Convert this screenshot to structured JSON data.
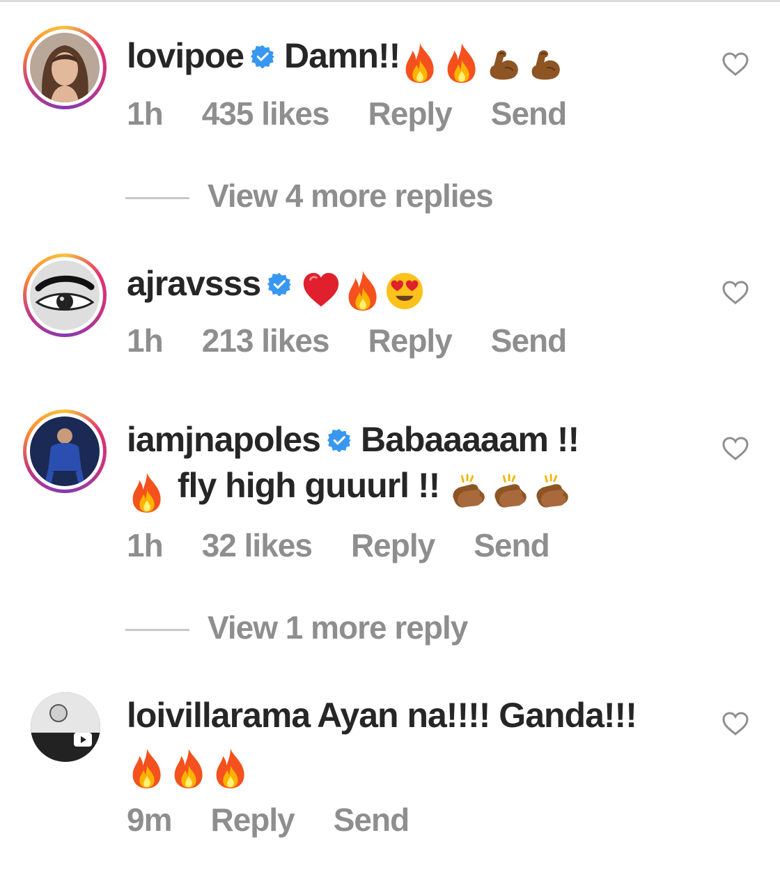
{
  "comments": [
    {
      "username": "lovipoe",
      "verified": true,
      "text": "Damn!!",
      "emoji": [
        "fire",
        "fire",
        "flexed-biceps",
        "flexed-biceps"
      ],
      "time": "1h",
      "likes": "435 likes",
      "reply_label": "Reply",
      "send_label": "Send",
      "view_replies": "View 4 more replies"
    },
    {
      "username": "ajravsss",
      "verified": true,
      "text": "",
      "emoji": [
        "red-heart",
        "fire",
        "heart-eyes"
      ],
      "time": "1h",
      "likes": "213 likes",
      "reply_label": "Reply",
      "send_label": "Send"
    },
    {
      "username": "iamjnapoles",
      "verified": true,
      "text": "Babaaaaam !!",
      "text_line2": "fly high guuurl !!",
      "emoji": [
        "fire",
        "clapping-hands",
        "clapping-hands",
        "clapping-hands"
      ],
      "time": "1h",
      "likes": "32 likes",
      "reply_label": "Reply",
      "send_label": "Send",
      "view_replies": "View 1 more reply"
    },
    {
      "username": "loivillarama",
      "verified": false,
      "text": "Ayan na!!!! Ganda!!!",
      "emoji": [
        "fire",
        "fire",
        "fire"
      ],
      "time": "9m",
      "reply_label": "Reply",
      "send_label": "Send"
    }
  ],
  "colors": {
    "text": "#262626",
    "meta": "#8e8e8e",
    "verified": "#3897f0",
    "divider": "#dbdbdb"
  }
}
